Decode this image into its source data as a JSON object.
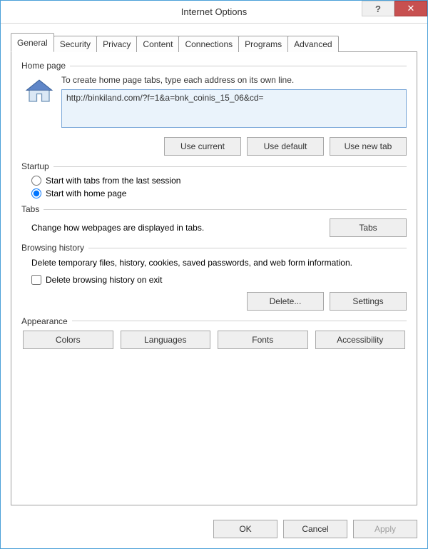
{
  "window": {
    "title": "Internet Options",
    "help_glyph": "?",
    "close_glyph": "✕"
  },
  "tabs": [
    "General",
    "Security",
    "Privacy",
    "Content",
    "Connections",
    "Programs",
    "Advanced"
  ],
  "homepage": {
    "group": "Home page",
    "instruction": "To create home page tabs, type each address on its own line.",
    "url": "http://binkiland.com/?f=1&a=bnk_coinis_15_06&cd=",
    "use_current": "Use current",
    "use_default": "Use default",
    "use_new_tab": "Use new tab"
  },
  "startup": {
    "group": "Startup",
    "opt_last": "Start with tabs from the last session",
    "opt_home": "Start with home page"
  },
  "tabs_section": {
    "group": "Tabs",
    "text": "Change how webpages are displayed in tabs.",
    "button": "Tabs"
  },
  "history": {
    "group": "Browsing history",
    "text": "Delete temporary files, history, cookies, saved passwords, and web form information.",
    "delete_on_exit": "Delete browsing history on exit",
    "delete": "Delete...",
    "settings": "Settings"
  },
  "appearance": {
    "group": "Appearance",
    "colors": "Colors",
    "languages": "Languages",
    "fonts": "Fonts",
    "accessibility": "Accessibility"
  },
  "dialog": {
    "ok": "OK",
    "cancel": "Cancel",
    "apply": "Apply"
  }
}
